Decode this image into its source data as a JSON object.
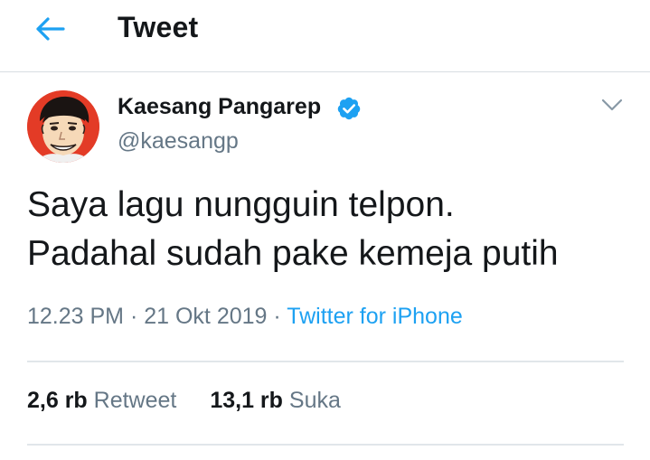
{
  "header": {
    "back_icon": "back-arrow-icon",
    "title": "Tweet"
  },
  "colors": {
    "accent": "#1da1f2",
    "text": "#14171a",
    "secondary": "#657786",
    "divider": "#e1e6ea"
  },
  "tweet": {
    "author": {
      "name": "Kaesang Pangarep",
      "handle": "@kaesangp",
      "verified_icon": "verified-badge-icon",
      "avatar_icon": "avatar-caricature"
    },
    "more_icon": "chevron-down-icon",
    "text_lines": [
      "Saya lagu nungguin telpon.",
      "Padahal sudah pake kemeja putih"
    ],
    "meta": {
      "time": "12.23 PM",
      "sep1": " · ",
      "date": "21 Okt 2019",
      "sep2": " · ",
      "source": "Twitter for iPhone"
    },
    "stats": {
      "retweets_count": "2,6 rb",
      "retweets_label": "Retweet",
      "likes_count": "13,1 rb",
      "likes_label": "Suka"
    }
  }
}
